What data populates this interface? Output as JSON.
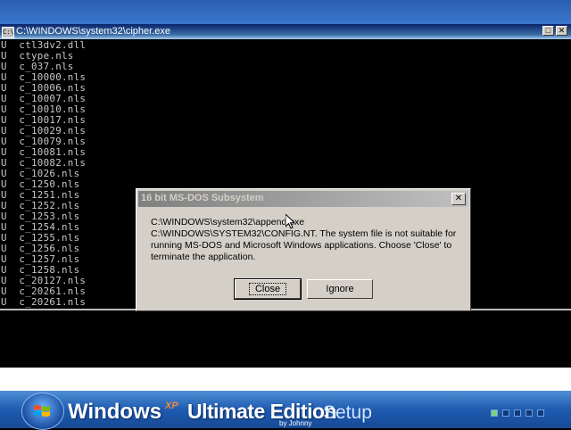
{
  "console": {
    "title": "C:\\WINDOWS\\system32\\cipher.exe",
    "icon": "cmd-icon",
    "icon_label": "C:\\",
    "minimize_label": "_",
    "maximize_label": "□",
    "close_label": "✕",
    "lines": [
      "U  ctl3dv2.dll",
      "U  ctype.nls",
      "U  c_037.nls",
      "U  c_10000.nls",
      "U  c_10006.nls",
      "U  c_10007.nls",
      "U  c_10010.nls",
      "U  c_10017.nls",
      "U  c_10029.nls",
      "U  c_10079.nls",
      "U  c_10081.nls",
      "U  c_10082.nls",
      "U  c_1026.nls",
      "U  c_1250.nls",
      "U  c_1251.nls",
      "U  c_1252.nls",
      "U  c_1253.nls",
      "U  c_1254.nls",
      "U  c_1255.nls",
      "U  c_1256.nls",
      "U  c_1257.nls",
      "U  c_1258.nls",
      "U  c_20127.nls",
      "U  c_20261.nls",
      "U  c_20261.nls"
    ]
  },
  "dialog": {
    "title": "16 bit MS-DOS Subsystem",
    "close_label": "✕",
    "message_line1": "C:\\WINDOWS\\system32\\append.exe",
    "message_line2": "C:\\WINDOWS\\SYSTEM32\\CONFIG.NT. The system file is not suitable for",
    "message_line3": "running MS-DOS and Microsoft Windows applications. Choose 'Close' to",
    "message_line4": "terminate the application.",
    "close_button": "Close",
    "ignore_button": "Ignore"
  },
  "footer": {
    "windows": "Windows",
    "xp": "XP",
    "edition": "Ultimate Edition",
    "setup": "Setup",
    "by": "by Johnny",
    "progress_squares": 5
  }
}
